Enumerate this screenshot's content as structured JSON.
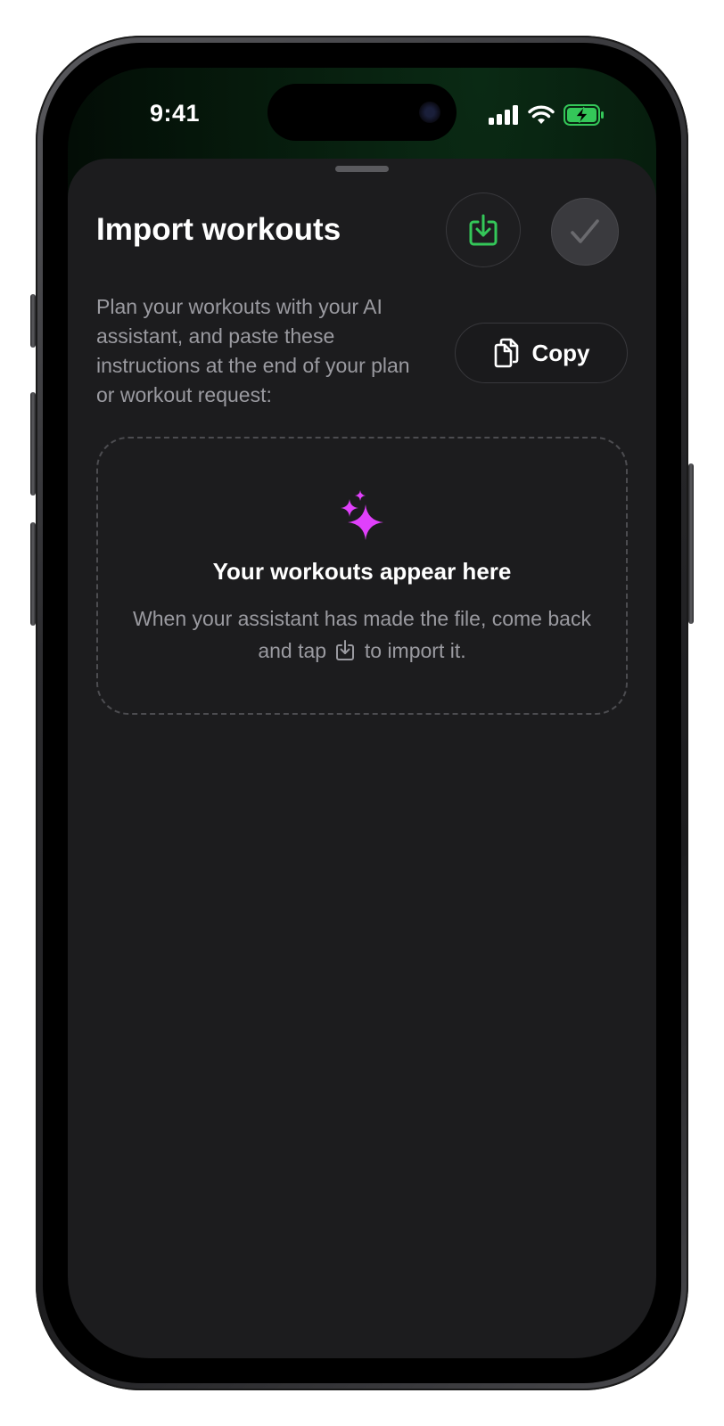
{
  "status_bar": {
    "time": "9:41"
  },
  "sheet": {
    "title": "Import workouts",
    "instructions": "Plan your workouts with your AI assistant, and paste these instructions at the end of your plan or workout request:",
    "copy_label": "Copy"
  },
  "empty_state": {
    "title": "Your workouts appear here",
    "body_before_icon": "When your assistant has made the file, come back and tap",
    "body_after_icon": "to import it."
  },
  "icons": {
    "import": "import-icon",
    "done": "checkmark-icon",
    "copy": "copy-icon",
    "sparkle": "sparkle-icon",
    "signal": "cellular-signal-icon",
    "wifi": "wifi-icon",
    "battery": "battery-charging-icon"
  },
  "colors": {
    "accent_green": "#34c759",
    "sparkle_magenta": "#e040fb",
    "sheet_background": "#1c1c1e"
  }
}
